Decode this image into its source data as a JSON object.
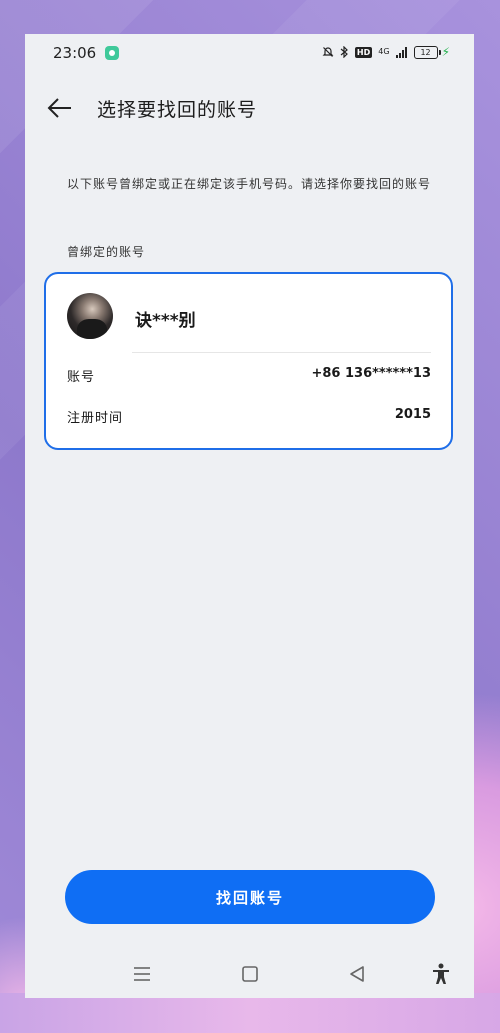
{
  "status_bar": {
    "time": "23:06",
    "hd_label": "HD",
    "network_label": "4G",
    "battery_level": "12"
  },
  "header": {
    "title": "选择要找回的账号"
  },
  "description": "以下账号曾绑定或正在绑定该手机号码。请选择你要找回的账号",
  "section_label": "曾绑定的账号",
  "account": {
    "name": "诀***别",
    "account_label": "账号",
    "account_value": "+86  136******13",
    "reg_time_label": "注册时间",
    "reg_time_value": "2015"
  },
  "primary_button": {
    "label": "找回账号"
  },
  "colors": {
    "accent": "#0f6ef4",
    "card_border": "#1f6ee8",
    "screen_bg": "#eef0f3"
  },
  "icons": {
    "back": "back-arrow-icon",
    "bell_muted": "bell-muted-icon",
    "bluetooth": "bluetooth-icon",
    "signal": "signal-icon",
    "battery": "battery-icon",
    "charging": "charging-icon",
    "nav_menu": "menu-icon",
    "nav_home": "home-square-icon",
    "nav_back": "triangle-back-icon",
    "accessibility": "accessibility-icon"
  }
}
